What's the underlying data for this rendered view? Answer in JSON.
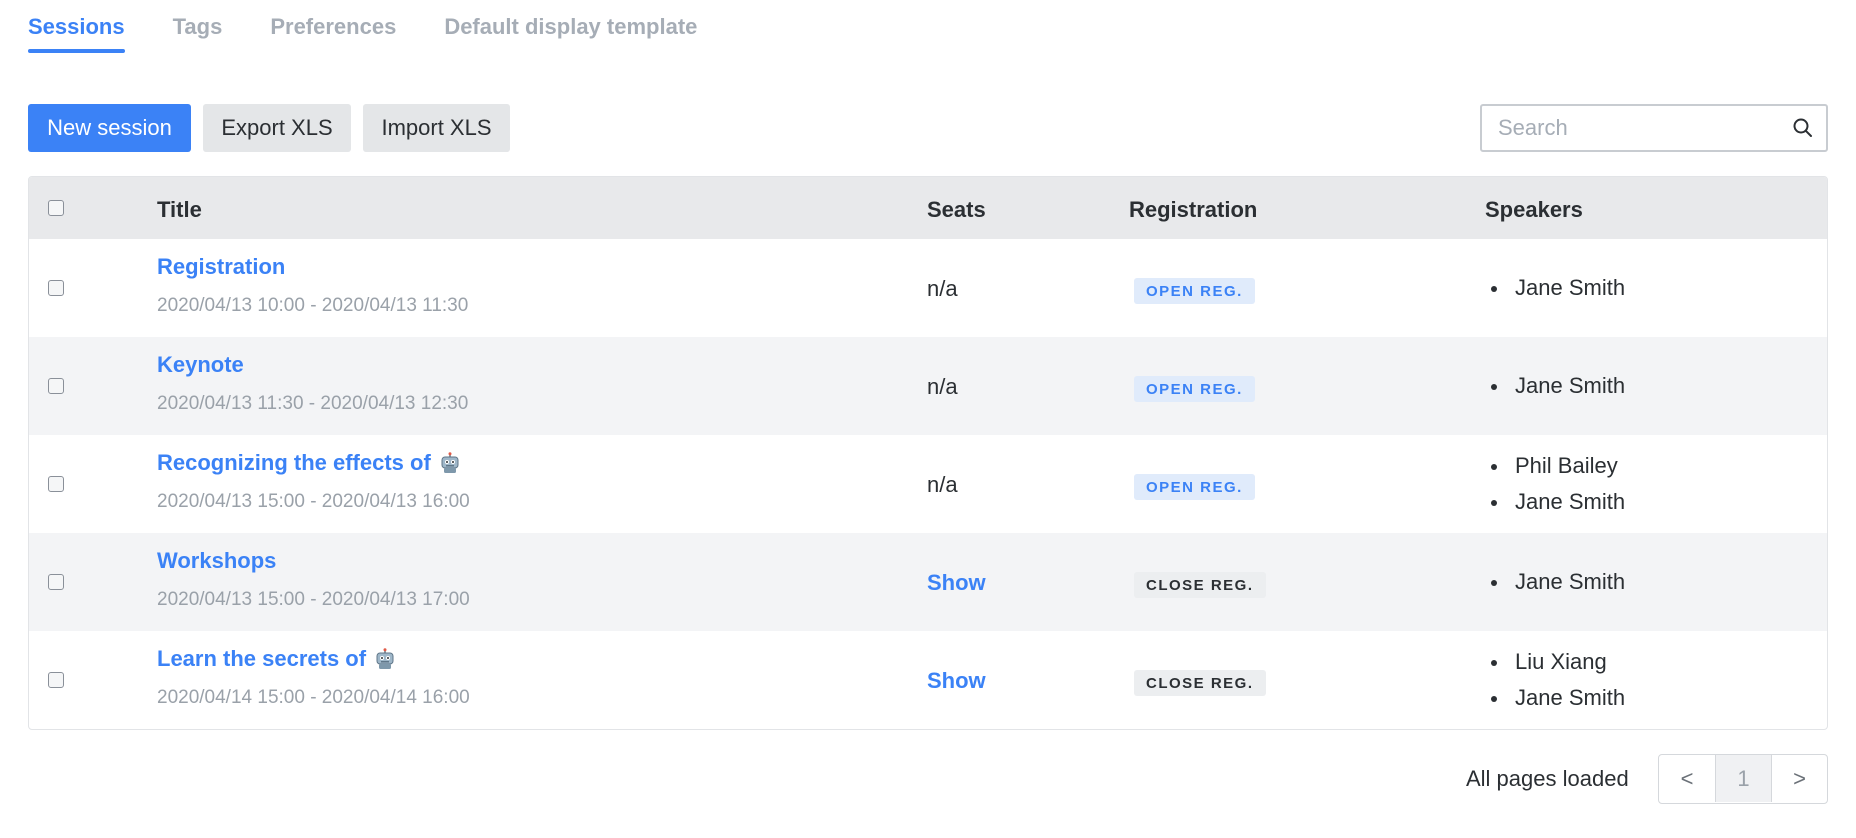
{
  "tabs": [
    {
      "label": "Sessions",
      "active": true
    },
    {
      "label": "Tags",
      "active": false
    },
    {
      "label": "Preferences",
      "active": false
    },
    {
      "label": "Default display template",
      "active": false
    }
  ],
  "toolbar": {
    "new_label": "New session",
    "export_label": "Export XLS",
    "import_label": "Import XLS"
  },
  "search": {
    "placeholder": "Search",
    "value": "",
    "icon": "search-icon"
  },
  "table": {
    "headers": {
      "title": "Title",
      "seats": "Seats",
      "registration": "Registration",
      "speakers": "Speakers"
    },
    "rows": [
      {
        "title": "Registration",
        "emoji": null,
        "time": "2020/04/13 10:00 - 2020/04/13 11:30",
        "seats": "n/a",
        "registration": "OPEN REG.",
        "speakers": [
          "Jane Smith"
        ]
      },
      {
        "title": "Keynote",
        "emoji": null,
        "time": "2020/04/13 11:30 - 2020/04/13 12:30",
        "seats": "n/a",
        "registration": "OPEN REG.",
        "speakers": [
          "Jane Smith"
        ]
      },
      {
        "title": "Recognizing the effects of",
        "emoji": "robot-icon",
        "time": "2020/04/13 15:00 - 2020/04/13 16:00",
        "seats": "n/a",
        "registration": "OPEN REG.",
        "speakers": [
          "Phil Bailey",
          "Jane Smith"
        ]
      },
      {
        "title": "Workshops",
        "emoji": null,
        "time": "2020/04/13 15:00 - 2020/04/13 17:00",
        "seats": "Show",
        "registration": "CLOSE REG.",
        "speakers": [
          "Jane Smith"
        ]
      },
      {
        "title": "Learn the secrets of",
        "emoji": "robot-icon",
        "time": "2020/04/14 15:00 - 2020/04/14 16:00",
        "seats": "Show",
        "registration": "CLOSE REG.",
        "speakers": [
          "Liu Xiang",
          "Jane Smith"
        ]
      }
    ]
  },
  "footer": {
    "status": "All pages loaded",
    "pager": {
      "prev": "<",
      "current": "1",
      "next": ">"
    }
  },
  "colors": {
    "accent": "#3b82f6",
    "header_bg": "#e8e9eb",
    "alt_row_bg": "#f3f4f6",
    "muted_text": "#9aa1a9"
  }
}
